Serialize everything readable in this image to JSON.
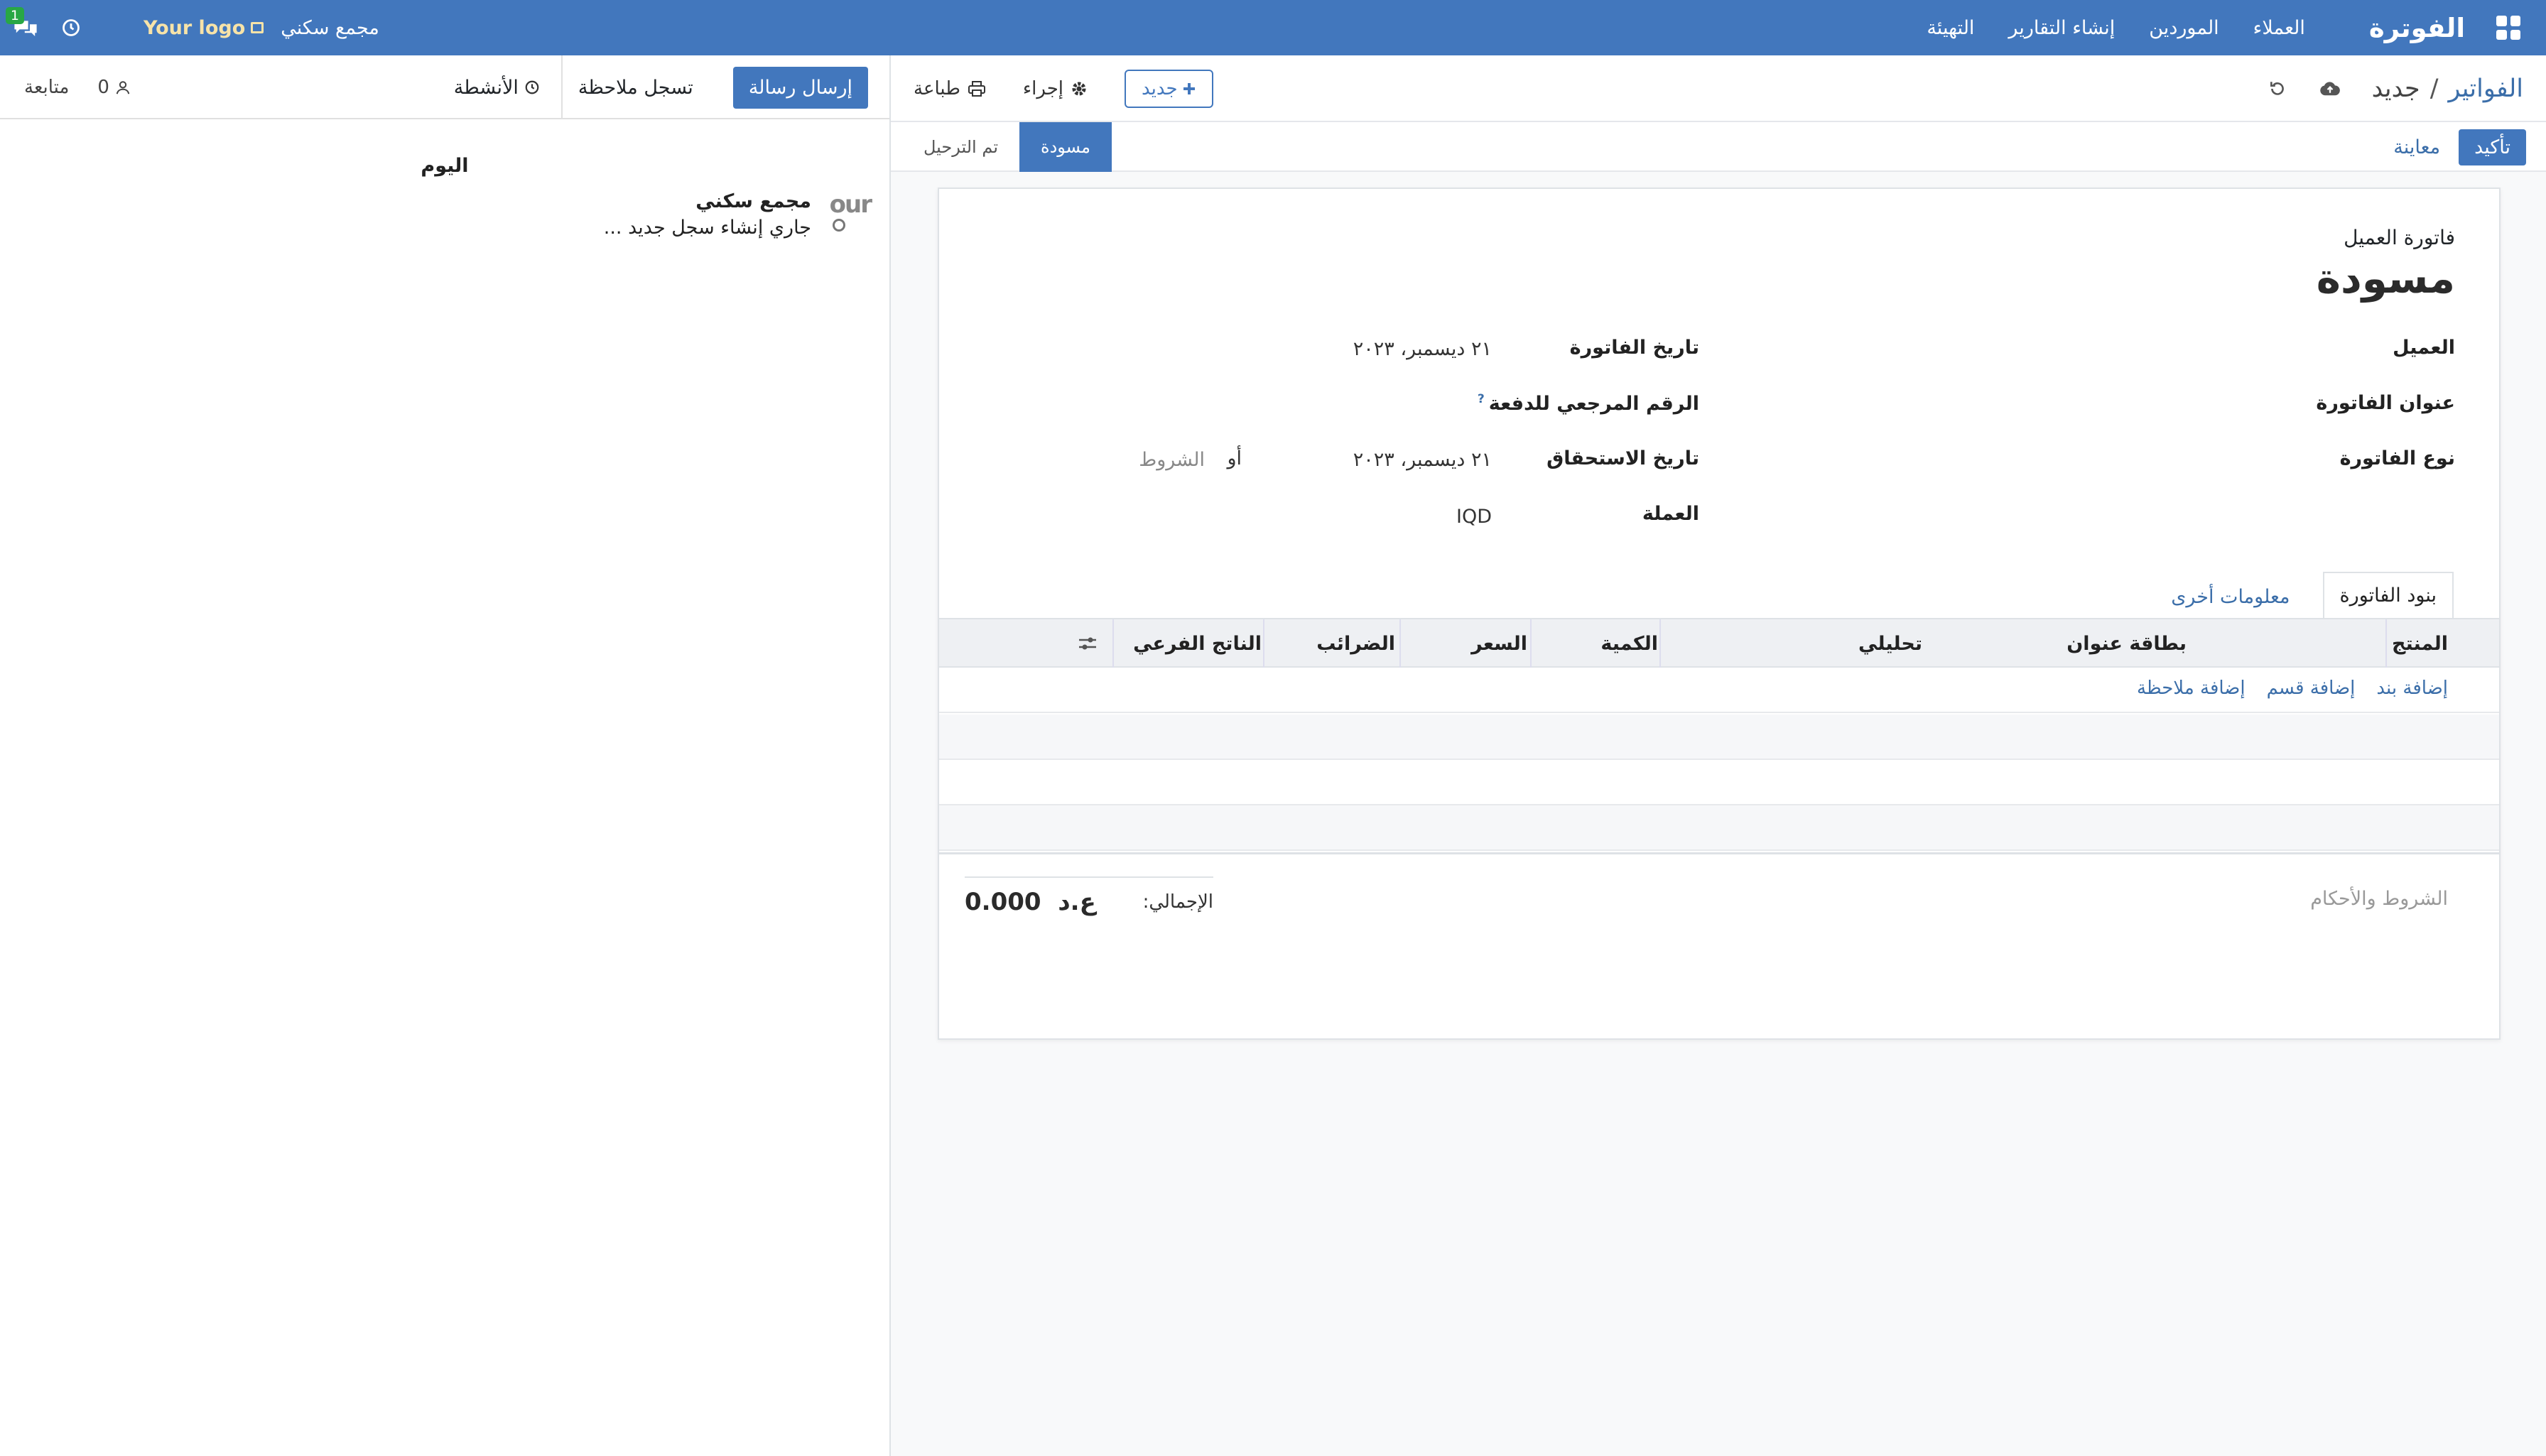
{
  "navbar": {
    "brand": "الفوترة",
    "menu": [
      "العملاء",
      "الموردين",
      "إنشاء التقارير",
      "التهيئة"
    ],
    "chat_badge": "1",
    "logo_text": "Your logo",
    "company": "مجمع سكني"
  },
  "control_panel": {
    "breadcrumb_root": "الفواتير",
    "breadcrumb_sep": "/",
    "breadcrumb_current": "جديد",
    "print_label": "طباعة",
    "action_label": "إجراء",
    "new_label": "جديد"
  },
  "statusbar": {
    "confirm_label": "تأكيد",
    "preview_label": "معاينة",
    "stages": [
      "مسودة",
      "تم الترحيل"
    ],
    "active_stage": "مسودة"
  },
  "form": {
    "kind": "فاتورة العميل",
    "name": "مسودة",
    "customer_label": "العميل",
    "invoice_address_label": "عنوان الفاتورة",
    "invoice_type_label": "نوع الفاتورة",
    "invoice_date_label": "تاريخ الفاتورة",
    "invoice_date_value": "٢١ ديسمبر، ٢٠٢٣",
    "payment_ref_label": "الرقم المرجعي للدفعة",
    "payment_ref_help": "?",
    "due_date_label": "تاريخ الاستحقاق",
    "due_date_value": "٢١ ديسمبر، ٢٠٢٣",
    "or_label": "أو",
    "terms_placeholder": "الشروط",
    "currency_label": "العملة",
    "currency_value": "IQD",
    "tabs": [
      "بنود الفاتورة",
      "معلومات أخرى"
    ],
    "columns": [
      "المنتج",
      "بطاقة عنوان",
      "تحليلي",
      "الكمية",
      "السعر",
      "الضرائب",
      "الناتج الفرعي"
    ],
    "add_links": [
      "إضافة بند",
      "إضافة قسم",
      "إضافة ملاحظة"
    ],
    "terms_conditions_placeholder": "الشروط والأحكام",
    "total_label": "الإجمالي:",
    "total_amount": "0.000",
    "total_currency": "ع.د"
  },
  "chatter": {
    "send_message_label": "إرسال رسالة",
    "log_note_label": "تسجل ملاحظة",
    "activities_label": "الأنشطة",
    "followers_count": "0",
    "follow_label": "متابعة",
    "date_separator": "اليوم",
    "message": {
      "avatar_text": "our",
      "author": "مجمع سكني",
      "text": "جاري إنشاء سجل جديد ..."
    }
  },
  "colors": {
    "primary": "#4277bd",
    "link": "#3b6ea9",
    "badge": "#28a745"
  }
}
